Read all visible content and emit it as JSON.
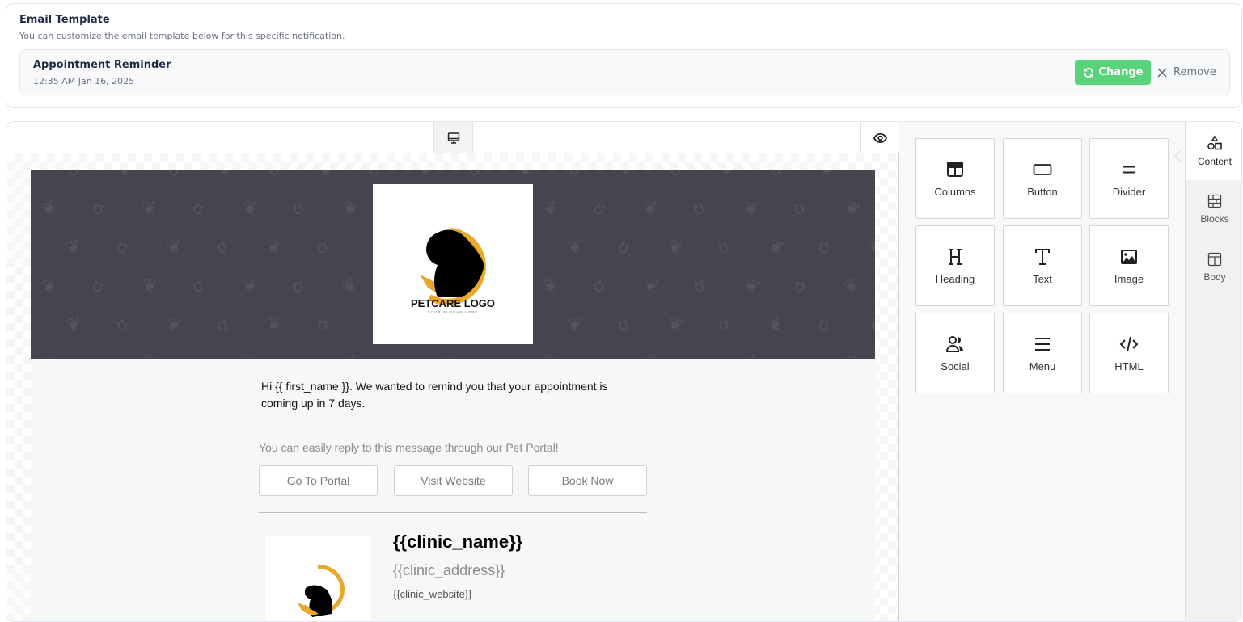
{
  "header": {
    "title": "Email Template",
    "subtitle": "You can customize the email template below for this specific notification."
  },
  "template": {
    "name": "Appointment Reminder",
    "date": "12:35 AM Jan 16, 2025",
    "change_label": "Change",
    "remove_label": "Remove",
    "change_color": "#5ad47b"
  },
  "toolbar": {
    "desktop_icon": "monitor-icon",
    "preview_icon": "eye-icon"
  },
  "email": {
    "hero_bg_color": "#45444f",
    "logo_text": "PETCARE LOGO",
    "logo_slogan": "YOUR SLOGAN HERE",
    "message": "Hi {{ first_name }}.  We wanted to remind you that your appointment is coming up in 7 days.",
    "reply_text": "You can easily reply to this message through our Pet Portal!",
    "buttons": [
      {
        "label": "Go To Portal"
      },
      {
        "label": "Visit Website"
      },
      {
        "label": "Book Now"
      }
    ],
    "clinic_name": "{{clinic_name}}",
    "clinic_address": "{{clinic_address}}",
    "clinic_website": "{{clinic_website}}"
  },
  "tools": [
    {
      "label": "Columns",
      "icon": "columns-icon"
    },
    {
      "label": "Button",
      "icon": "button-icon"
    },
    {
      "label": "Divider",
      "icon": "divider-icon"
    },
    {
      "label": "Heading",
      "icon": "heading-icon"
    },
    {
      "label": "Text",
      "icon": "text-icon"
    },
    {
      "label": "Image",
      "icon": "image-icon"
    },
    {
      "label": "Social",
      "icon": "social-icon"
    },
    {
      "label": "Menu",
      "icon": "menu-icon"
    },
    {
      "label": "HTML",
      "icon": "code-icon"
    }
  ],
  "side_tabs": [
    {
      "label": "Content",
      "icon": "shapes-icon",
      "active": true
    },
    {
      "label": "Blocks",
      "icon": "blocks-icon",
      "active": false
    },
    {
      "label": "Body",
      "icon": "body-layout-icon",
      "active": false
    }
  ]
}
